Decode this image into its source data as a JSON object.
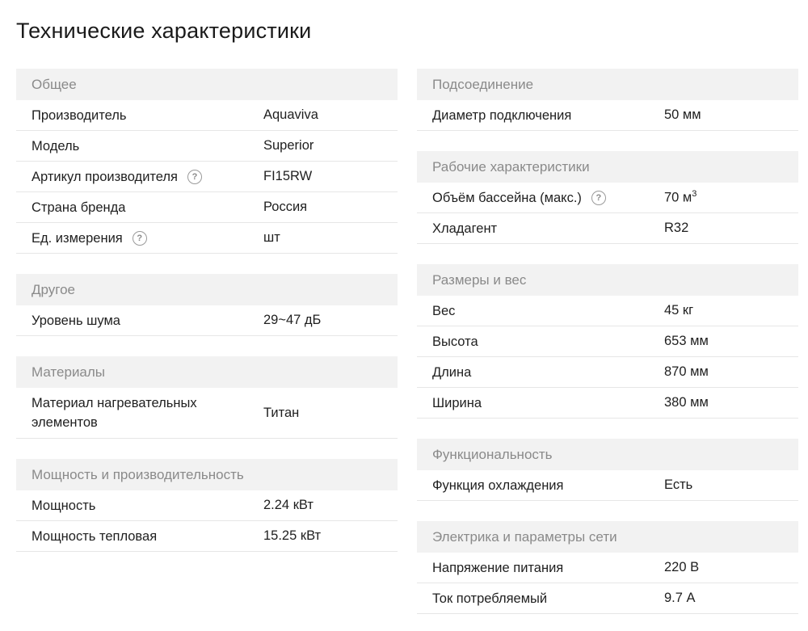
{
  "title": "Технические характеристики",
  "left": [
    {
      "header": "Общее",
      "rows": [
        {
          "label": "Производитель",
          "value": "Aquaviva",
          "help": false
        },
        {
          "label": "Модель",
          "value": "Superior",
          "help": false
        },
        {
          "label": "Артикул производителя",
          "value": "FI15RW",
          "help": true
        },
        {
          "label": "Страна бренда",
          "value": "Россия",
          "help": false
        },
        {
          "label": "Ед. измерения",
          "value": "шт",
          "help": true
        }
      ]
    },
    {
      "header": "Другое",
      "rows": [
        {
          "label": "Уровень шума",
          "value": "29~47 дБ",
          "help": false
        }
      ]
    },
    {
      "header": "Материалы",
      "rows": [
        {
          "label": "Материал нагревательных элементов",
          "value": "Титан",
          "help": false,
          "tall": true
        }
      ]
    },
    {
      "header": "Мощность и производительность",
      "rows": [
        {
          "label": "Мощность",
          "value": "2.24 кВт",
          "help": false
        },
        {
          "label": "Мощность тепловая",
          "value": "15.25 кВт",
          "help": false
        }
      ]
    }
  ],
  "right": [
    {
      "header": "Подсоединение",
      "rows": [
        {
          "label": "Диаметр подключения",
          "value": "50 мм",
          "help": false
        }
      ]
    },
    {
      "header": "Рабочие характеристики",
      "rows": [
        {
          "label": "Объём бассейна (макс.)",
          "value": "70 м",
          "sup": "3",
          "help": true
        },
        {
          "label": "Хладагент",
          "value": "R32",
          "help": false
        }
      ]
    },
    {
      "header": "Размеры и вес",
      "rows": [
        {
          "label": "Вес",
          "value": "45 кг",
          "help": false
        },
        {
          "label": "Высота",
          "value": "653 мм",
          "help": false
        },
        {
          "label": "Длина",
          "value": "870 мм",
          "help": false
        },
        {
          "label": "Ширина",
          "value": "380 мм",
          "help": false
        }
      ]
    },
    {
      "header": "Функциональность",
      "rows": [
        {
          "label": "Функция охлаждения",
          "value": "Есть",
          "help": false
        }
      ]
    },
    {
      "header": "Электрика и параметры сети",
      "rows": [
        {
          "label": "Напряжение питания",
          "value": "220 В",
          "help": false
        },
        {
          "label": "Ток потребляемый",
          "value": "9.7 А",
          "help": false
        }
      ]
    }
  ],
  "help_icon_glyph": "?"
}
